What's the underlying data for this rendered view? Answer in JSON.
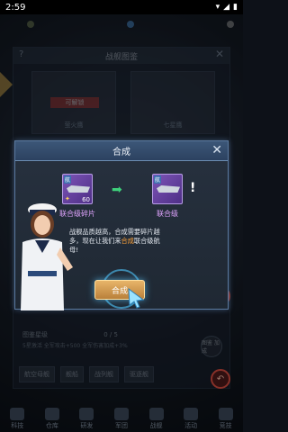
{
  "status_bar": {
    "time": "2:59",
    "icons": [
      "wifi-icon",
      "signal-icon",
      "battery-icon"
    ]
  },
  "background": {
    "encyclopedia_title": "战舰图鉴",
    "card_left_label": "萤火鹰",
    "card_right_label": "七星鹰",
    "card_left_badge": "可解锁",
    "progress_label": "图鉴星级",
    "progress_value": "0 / 5",
    "bonus_text": "5星激活 全军攻击+500 全军伤害加成+3%",
    "tabs": [
      "航空母舰",
      "舰船",
      "战列舰",
      "驱逐舰"
    ],
    "side_button": "图鉴\n加成",
    "nav": [
      "科技",
      "仓库",
      "研发",
      "军团",
      "战舰",
      "活动",
      "竞技"
    ]
  },
  "dialog": {
    "title": "合成",
    "source_item": {
      "label": "联合级碎片",
      "count": "60",
      "tag": "航"
    },
    "target_item": {
      "label": "联合级",
      "tag": "航"
    },
    "message_part1": "战舰品质越高，合成需要碎片越多，现在让我们来",
    "message_highlight": "合成",
    "message_part2": "联合级航母!",
    "button_label": "合成"
  },
  "colors": {
    "accent": "#5b7aa0",
    "button": "#e8b56a",
    "highlight": "#ffa33a",
    "item_purple": "#7c54b6",
    "arrow_green": "#3ed07b"
  }
}
